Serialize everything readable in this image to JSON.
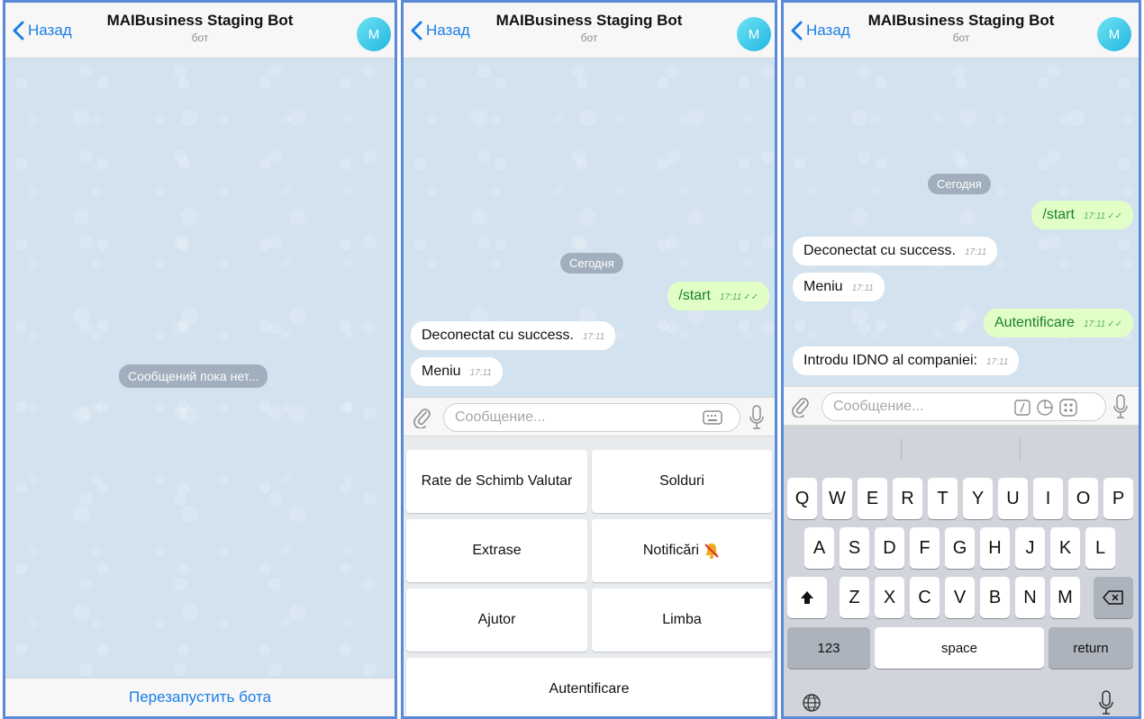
{
  "header": {
    "back_label": "Назад",
    "title": "MAIBusiness Staging Bot",
    "subtitle": "бот",
    "avatar_letter": "M"
  },
  "panel1": {
    "empty_text": "Сообщений пока нет...",
    "restart_label": "Перезапустить бота"
  },
  "panel2": {
    "date_pill": "Сегодня",
    "messages": [
      {
        "text": "/start",
        "time": "17:11",
        "direction": "out"
      },
      {
        "text": "Deconectat cu success.",
        "time": "17:11",
        "direction": "in"
      },
      {
        "text": "Meniu",
        "time": "17:11",
        "direction": "in"
      }
    ],
    "input_placeholder": "Сообщение...",
    "keyboard_buttons": [
      "Rate de Schimb Valutar",
      "Solduri",
      "Extrase",
      "Notificări",
      "Ajutor",
      "Limba",
      "Autentificare"
    ]
  },
  "panel3": {
    "date_pill": "Сегодня",
    "messages": [
      {
        "text": "/start",
        "time": "17:11",
        "direction": "out"
      },
      {
        "text": "Deconectat cu success.",
        "time": "17:11",
        "direction": "in"
      },
      {
        "text": "Meniu",
        "time": "17:11",
        "direction": "in"
      },
      {
        "text": "Autentificare",
        "time": "17:11",
        "direction": "out"
      },
      {
        "text": "Introdu IDNO al companiei:",
        "time": "17:11",
        "direction": "in"
      }
    ],
    "input_placeholder": "Сообщение...",
    "keys": {
      "row1": [
        "Q",
        "W",
        "E",
        "R",
        "T",
        "Y",
        "U",
        "I",
        "O",
        "P"
      ],
      "row2": [
        "A",
        "S",
        "D",
        "F",
        "G",
        "H",
        "J",
        "K",
        "L"
      ],
      "row3": [
        "Z",
        "X",
        "C",
        "V",
        "B",
        "N",
        "M"
      ],
      "numbers": "123",
      "space": "space",
      "return": "return"
    }
  },
  "colors": {
    "accent": "#1a7ee6",
    "chat_bg": "#d3e2ef",
    "outgoing_bubble": "#e1fec6",
    "outgoing_text": "#1d7f2e",
    "border": "#5b8ad6"
  },
  "icons": [
    "chevron-left-icon",
    "paperclip-icon",
    "keyboard-icon",
    "microphone-icon",
    "bell-muted-icon",
    "slash-command-icon",
    "sticker-icon",
    "grid-icon",
    "shift-icon",
    "backspace-icon",
    "globe-icon"
  ]
}
